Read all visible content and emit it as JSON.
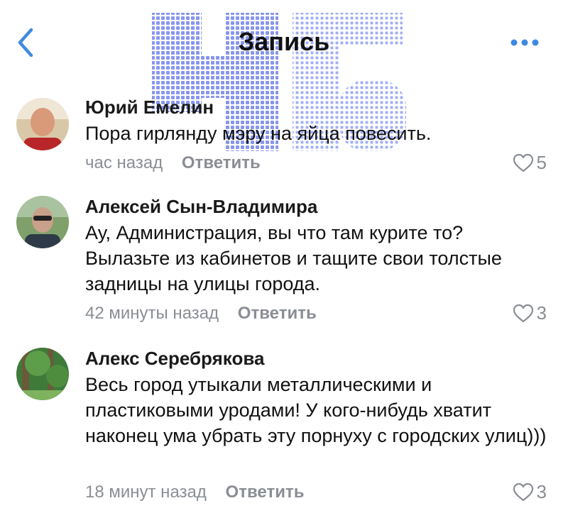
{
  "header": {
    "title": "Запись"
  },
  "comments": [
    {
      "author": "Юрий Емелин",
      "text": "Пора гирлянду мэру на яйца повесить.",
      "time": "час назад",
      "reply": "Ответить",
      "likes": "5"
    },
    {
      "author": "Алексей Сын-Владимира",
      "text": "Ау,  Администрация, вы что там курите то? Вылазьте из кабинетов и тащите свои толстые задницы на улицы города.",
      "time": "42 минуты назад",
      "reply": "Ответить",
      "likes": "3"
    },
    {
      "author": "Алекс Серебрякова",
      "text": "Весь город утыкали металлическими и пластиковыми уродами! У кого-нибудь хватит наконец ума убрать эту порнуху с городских улиц)))",
      "time": "18 минут назад",
      "reply": "Ответить",
      "likes": "3"
    }
  ],
  "colors": {
    "accent": "#3f8ae0",
    "muted": "#8a8e94",
    "watermark": "#5a6fe6"
  },
  "icons": {
    "back": "chevron-left-icon",
    "more": "ellipsis-icon",
    "like": "heart-outline-icon"
  }
}
